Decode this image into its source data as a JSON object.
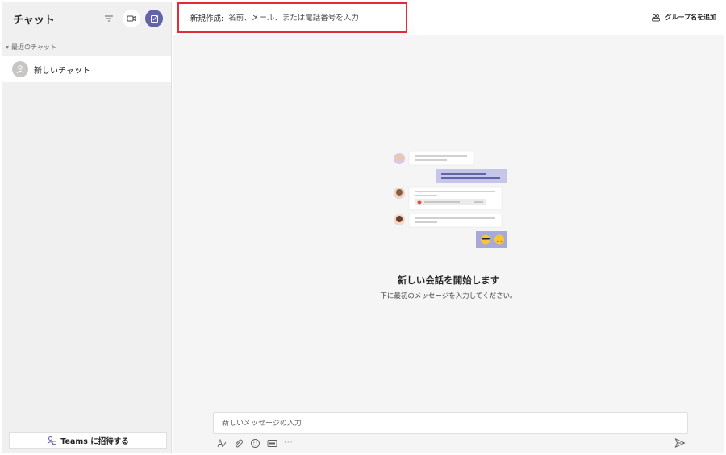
{
  "sidebar": {
    "title": "チャット",
    "section_label": "最近のチャット",
    "items": [
      {
        "label": "新しいチャット"
      }
    ],
    "invite_label": "Teams に招待する"
  },
  "header": {
    "to_label": "新規作成:",
    "to_placeholder": "名前、メール、または電話番号を入力",
    "group_name_label": "グループ名を追加"
  },
  "main": {
    "empty_title": "新しい会話を開始します",
    "empty_subtitle": "下に最初のメッセージを入力してください。"
  },
  "composer": {
    "placeholder": "新しいメッセージの入力",
    "more_label": "···"
  },
  "colors": {
    "accent": "#6264a7",
    "highlight_border": "#e52b35"
  }
}
